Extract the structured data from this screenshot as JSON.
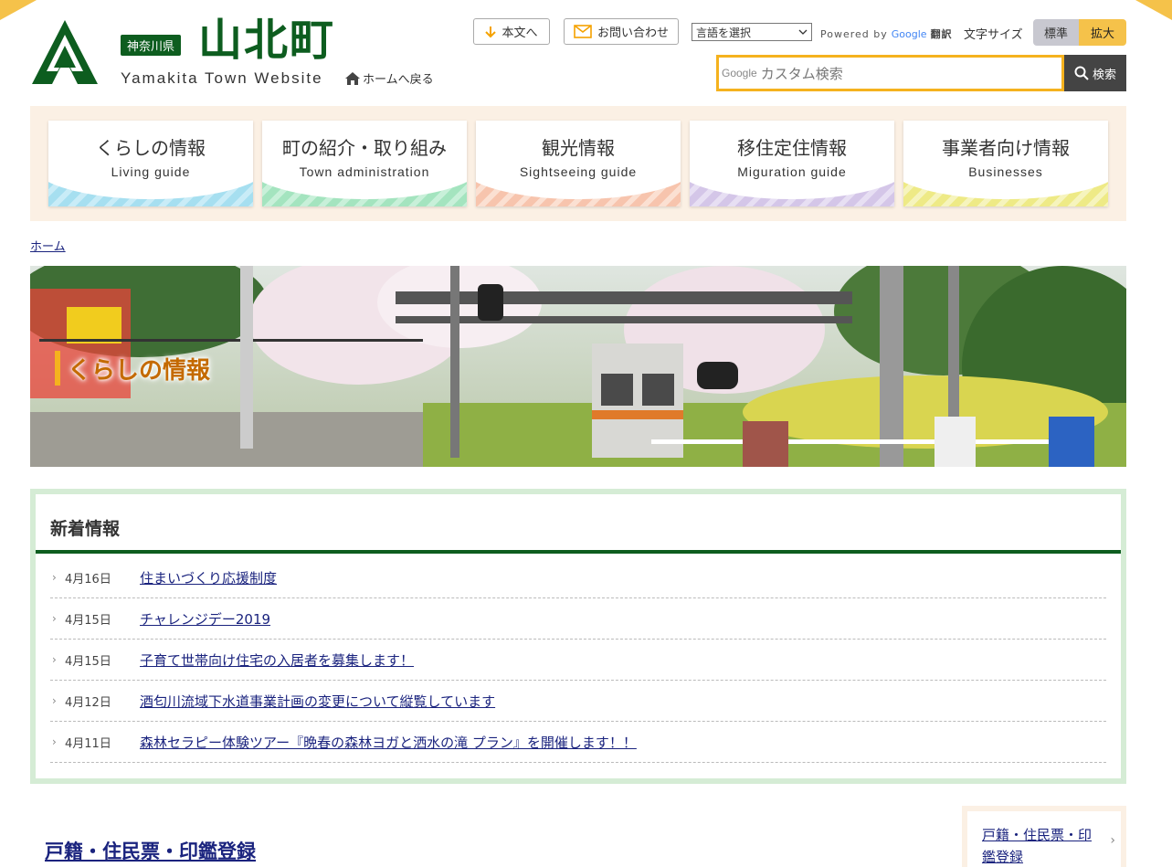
{
  "header": {
    "prefecture": "神奈川県",
    "town_name": "山北町",
    "site_subtitle": "Yamakita Town Website",
    "home_link": "ホームへ戻る",
    "skip_to_main": "本文へ",
    "contact": "お問い合わせ",
    "language_select": "言語を選択",
    "powered_by": "Powered by",
    "google": "Google",
    "translate": "翻訳",
    "font_size_label": "文字サイズ",
    "font_size_standard": "標準",
    "font_size_large": "拡大",
    "search_brand": "Google",
    "search_placeholder": "カスタム検索",
    "search_button": "検索"
  },
  "global_nav": [
    {
      "jp": "くらしの情報",
      "en": "Living guide",
      "color": "#a6dff0"
    },
    {
      "jp": "町の紹介・取り組み",
      "en": "Town administration",
      "color": "#a4e4bf"
    },
    {
      "jp": "観光情報",
      "en": "Sightseeing guide",
      "color": "#f7c4ad"
    },
    {
      "jp": "移住定住情報",
      "en": "Miguration guide",
      "color": "#d4c6e8"
    },
    {
      "jp": "事業者向け情報",
      "en": "Businesses",
      "color": "#eeea86"
    }
  ],
  "breadcrumb": "ホーム",
  "hero": {
    "title": "くらしの情報"
  },
  "news": {
    "heading": "新着情報",
    "items": [
      {
        "date": "4月16日",
        "title": "住まいづくり応援制度"
      },
      {
        "date": "4月15日",
        "title": "チャレンジデー2019"
      },
      {
        "date": "4月15日",
        "title": "子育て世帯向け住宅の入居者を募集します！"
      },
      {
        "date": "4月12日",
        "title": "酒匂川流域下水道事業計画の変更について縦覧しています"
      },
      {
        "date": "4月11日",
        "title": "森林セラピー体験ツアー『晩春の森林ヨガと洒水の滝 プラン』を開催します！！"
      }
    ]
  },
  "section": {
    "title": "戸籍・住民票・印鑑登録",
    "side_link": "戸籍・住民票・印鑑登録"
  },
  "colors": {
    "brand_green": "#0d5d1f",
    "accent_yellow": "#f5b21e",
    "link": "#1a237e"
  }
}
